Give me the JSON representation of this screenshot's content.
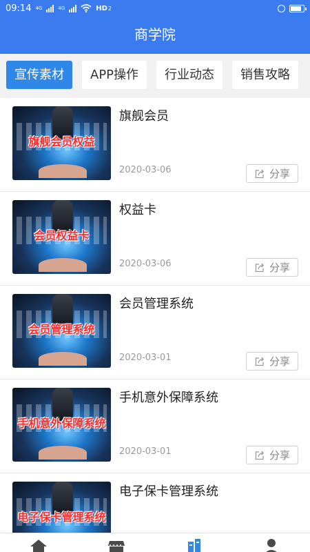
{
  "status_bar": {
    "time": "09:14",
    "net1": "4G",
    "net2": "4G",
    "hd": "HD",
    "hd_num": "2",
    "battery_level": 0.9
  },
  "header": {
    "title": "商学院"
  },
  "tabs": [
    {
      "label": "宣传素材",
      "active": true
    },
    {
      "label": "APP操作",
      "active": false
    },
    {
      "label": "行业动态",
      "active": false
    },
    {
      "label": "销售攻略",
      "active": false
    }
  ],
  "items": [
    {
      "title": "旗舰会员",
      "thumb_caption": "旗舰会员权益",
      "date": "2020-03-06",
      "share_label": "分享"
    },
    {
      "title": "权益卡",
      "thumb_caption": "会员权益卡",
      "date": "2020-03-06",
      "share_label": "分享"
    },
    {
      "title": "会员管理系统",
      "thumb_caption": "会员管理系统",
      "date": "2020-03-01",
      "share_label": "分享"
    },
    {
      "title": "手机意外保障系统",
      "thumb_caption": "手机意外保障系统",
      "date": "2020-03-01",
      "share_label": "分享"
    },
    {
      "title": "电子保卡管理系统",
      "thumb_caption": "电子保卡管理系统",
      "date": "",
      "share_label": ""
    }
  ],
  "bottom_nav": [
    {
      "icon": "home-icon",
      "active": false
    },
    {
      "icon": "store-icon",
      "active": false
    },
    {
      "icon": "building-icon",
      "active": true
    },
    {
      "icon": "user-icon",
      "active": false
    }
  ],
  "colors": {
    "primary": "#3a7cf0",
    "tab_active": "#2f87e8",
    "caption_red": "#ff2a2a"
  }
}
